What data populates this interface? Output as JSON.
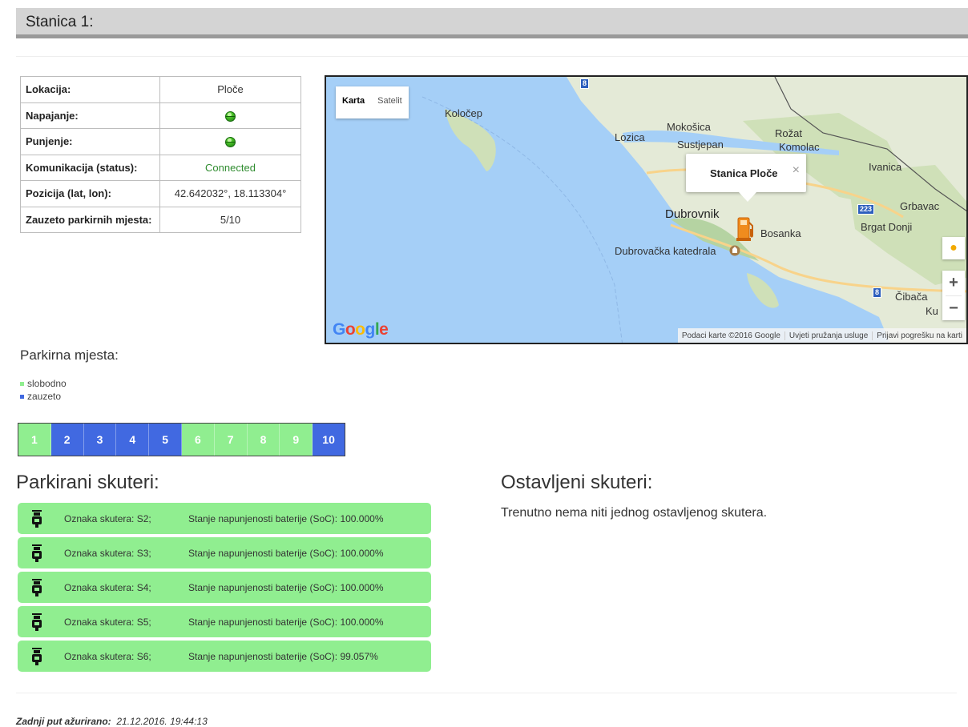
{
  "station": {
    "title": "Stanica 1:"
  },
  "info_table": {
    "rows": [
      {
        "label": "Lokacija:",
        "value": "Ploče"
      },
      {
        "label": "Napajanje:",
        "value": ""
      },
      {
        "label": "Punjenje:",
        "value": ""
      },
      {
        "label": "Komunikacija (status):",
        "value": "Connected"
      },
      {
        "label": "Pozicija (lat, lon):",
        "value": "42.642032°, 18.113304°"
      },
      {
        "label": "Zauzeto parkirnih mjesta:",
        "value": "5/10"
      }
    ]
  },
  "map": {
    "type_buttons": [
      "Karta",
      "Satelit"
    ],
    "places": [
      "Koločep",
      "Lozica",
      "Mokošica",
      "Sustjepan",
      "Rožat",
      "Komolac",
      "Ivanica",
      "Grbavac",
      "Brgat Donji",
      "Dubrovnik",
      "Bosanka",
      "Dubrovačka katedrala",
      "Čibača",
      "Ku"
    ],
    "shields": [
      "8",
      "223",
      "8"
    ],
    "infowindow": {
      "title": "Stanica Ploče",
      "close": "×"
    },
    "zoom_in": "+",
    "zoom_out": "−",
    "logo": [
      "G",
      "o",
      "o",
      "g",
      "l",
      "e"
    ],
    "attribution": [
      "Podaci karte ©2016 Google",
      "Uvjeti pružanja usluge",
      "Prijavi pogrešku na karti"
    ]
  },
  "parking": {
    "title": "Parkirna mjesta:",
    "legend": [
      {
        "label": "slobodno",
        "color": "#90ee90"
      },
      {
        "label": "zauzeto",
        "color": "#4169e1"
      }
    ],
    "slots": [
      {
        "n": "1",
        "state": "free"
      },
      {
        "n": "2",
        "state": "taken"
      },
      {
        "n": "3",
        "state": "taken"
      },
      {
        "n": "4",
        "state": "taken"
      },
      {
        "n": "5",
        "state": "taken"
      },
      {
        "n": "6",
        "state": "free"
      },
      {
        "n": "7",
        "state": "free"
      },
      {
        "n": "8",
        "state": "free"
      },
      {
        "n": "9",
        "state": "free"
      },
      {
        "n": "10",
        "state": "taken"
      }
    ]
  },
  "parked": {
    "title": "Parkirani skuteri:",
    "items": [
      {
        "label": "Oznaka skutera: S2;",
        "soc": "Stanje napunjenosti baterije (SoC): 100.000%"
      },
      {
        "label": "Oznaka skutera: S3;",
        "soc": "Stanje napunjenosti baterije (SoC): 100.000%"
      },
      {
        "label": "Oznaka skutera: S4;",
        "soc": "Stanje napunjenosti baterije (SoC): 100.000%"
      },
      {
        "label": "Oznaka skutera: S5;",
        "soc": "Stanje napunjenosti baterije (SoC): 100.000%"
      },
      {
        "label": "Oznaka skutera: S6;",
        "soc": "Stanje napunjenosti baterije (SoC): 99.057%"
      }
    ]
  },
  "left": {
    "title": "Ostavljeni skuteri:",
    "empty_text": "Trenutno nema niti jednog ostavljenog skutera."
  },
  "footer": {
    "label": "Zadnji put ažurirano:",
    "value": "21.12.2016. 19:44:13"
  }
}
